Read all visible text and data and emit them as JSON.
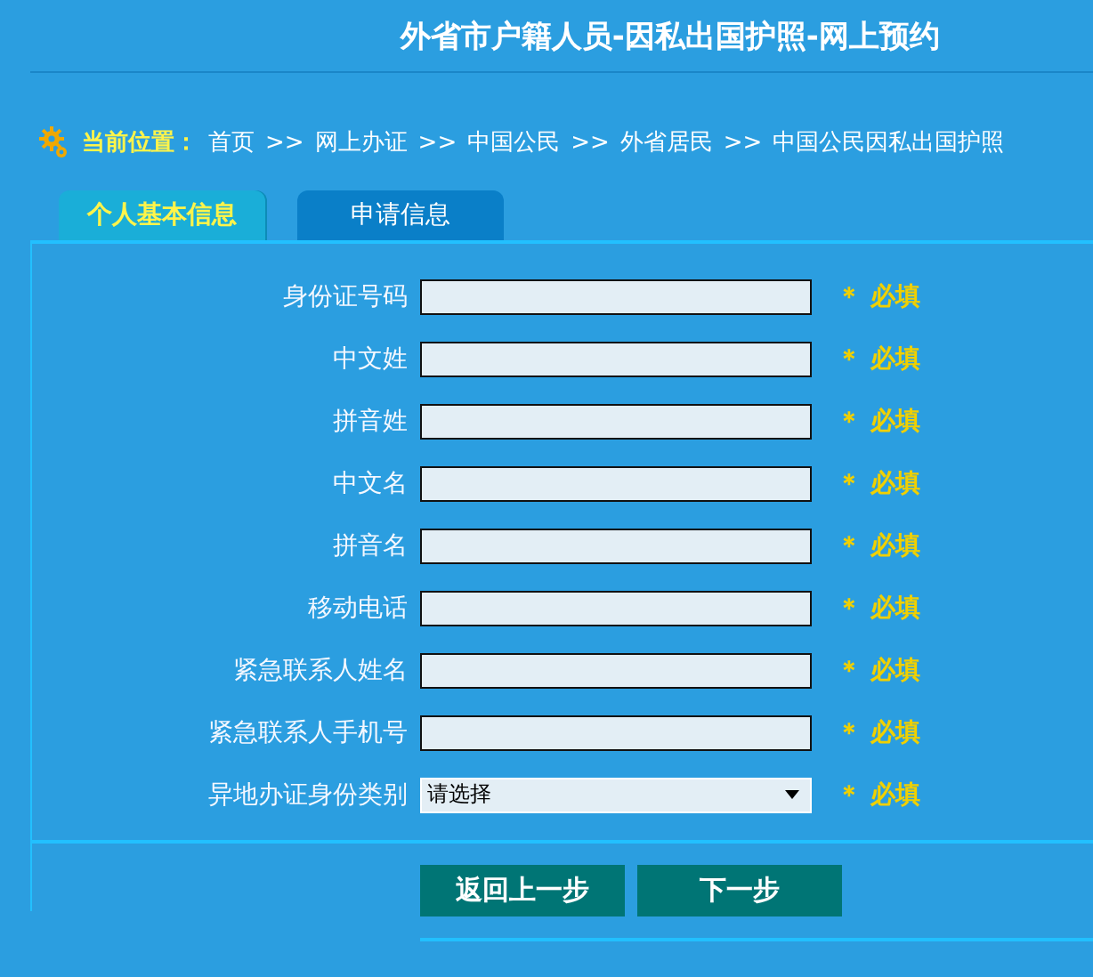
{
  "title": "外省市户籍人员-因私出国护照-网上预约",
  "breadcrumb": {
    "label": "当前位置：",
    "items": [
      "首页",
      "网上办证",
      "中国公民",
      "外省居民",
      "中国公民因私出国护照"
    ],
    "separator": ">>"
  },
  "tabs": [
    {
      "label": "个人基本信息",
      "selected": true
    },
    {
      "label": "申请信息",
      "selected": false
    }
  ],
  "fields": [
    {
      "label": "身份证号码",
      "kind": "text",
      "required": "＊ 必填"
    },
    {
      "label": "中文姓",
      "kind": "text",
      "required": "＊ 必填"
    },
    {
      "label": "拼音姓",
      "kind": "text",
      "required": "＊ 必填"
    },
    {
      "label": "中文名",
      "kind": "text",
      "required": "＊ 必填"
    },
    {
      "label": "拼音名",
      "kind": "text",
      "required": "＊ 必填"
    },
    {
      "label": "移动电话",
      "kind": "text",
      "required": "＊ 必填"
    },
    {
      "label": "紧急联系人姓名",
      "kind": "text",
      "required": "＊ 必填"
    },
    {
      "label": "紧急联系人手机号",
      "kind": "text",
      "required": "＊ 必填"
    },
    {
      "label": "异地办证身份类别",
      "kind": "select",
      "value": "请选择",
      "required": "＊ 必填"
    }
  ],
  "buttons": [
    "返回上一步",
    "下一步"
  ]
}
